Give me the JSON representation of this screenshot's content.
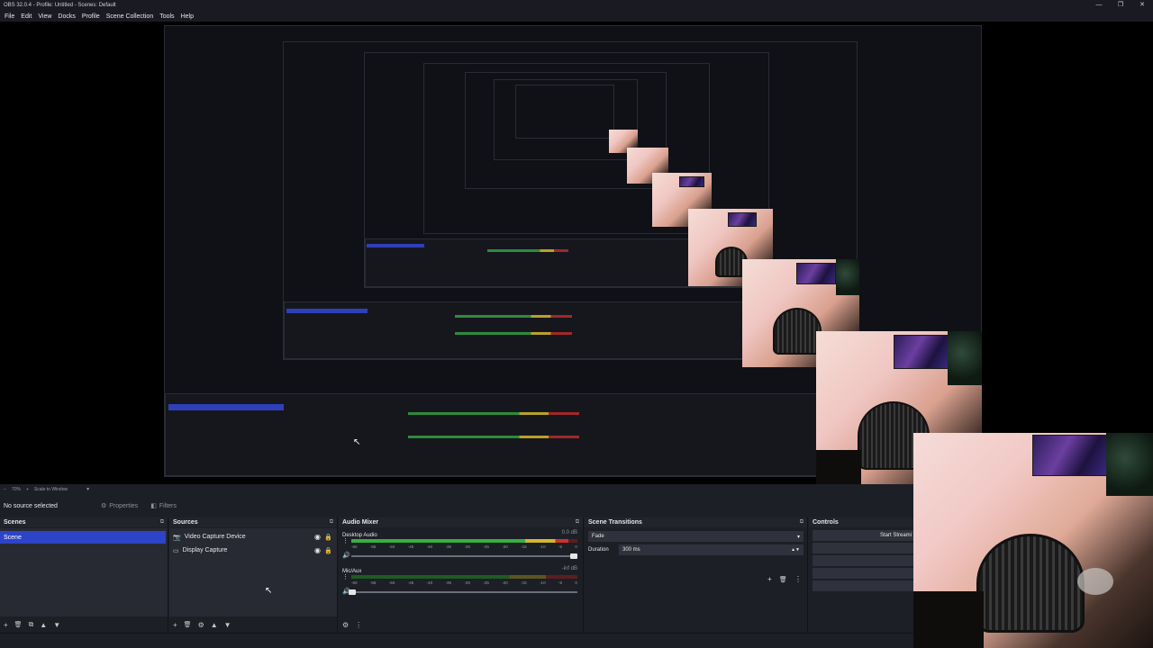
{
  "window": {
    "title": "OBS 32.0.4 - Profile: Untitled - Scenes: Default",
    "controls": [
      "—",
      "❐",
      "✕"
    ]
  },
  "menu": [
    "File",
    "Edit",
    "View",
    "Docks",
    "Profile",
    "Scene Collection",
    "Tools",
    "Help"
  ],
  "preview": {
    "zoom": "70%",
    "scale_mode": "Scale to Window"
  },
  "source_toolbar": {
    "no_source": "No source selected",
    "properties": "Properties",
    "filters": "Filters"
  },
  "scenes": {
    "title": "Scenes",
    "items": [
      "Scene"
    ],
    "footer_icons": [
      "+",
      "🗑",
      "⧉",
      "▲",
      "▼"
    ]
  },
  "sources": {
    "title": "Sources",
    "items": [
      {
        "label": "Video Capture Device",
        "icon": "camera-icon"
      },
      {
        "label": "Display Capture",
        "icon": "monitor-icon"
      }
    ],
    "footer_icons": [
      "+",
      "🗑",
      "⚙",
      "▲",
      "▼"
    ]
  },
  "audio_mixer": {
    "title": "Audio Mixer",
    "channels": [
      {
        "name": "Desktop Audio",
        "db": "0.0 dB",
        "level": 0.96,
        "volume": 1.0
      },
      {
        "name": "Mic/Aux",
        "db": "-inf dB",
        "level": 0.0,
        "volume": 0.02
      }
    ],
    "ticks": [
      "-60",
      "-55",
      "-50",
      "-45",
      "-40",
      "-35",
      "-30",
      "-25",
      "-20",
      "-15",
      "-10",
      "-5",
      "0"
    ],
    "footer_icons": [
      "⚙",
      "⋮"
    ]
  },
  "transitions": {
    "title": "Scene Transitions",
    "selected": "Fade",
    "duration_label": "Duration",
    "duration_value": "300 ms",
    "tools": [
      "+",
      "🗑",
      "⋮"
    ]
  },
  "controls": {
    "title": "Controls",
    "start_streaming": "Start Streami"
  },
  "colors": {
    "accent": "#2d43c8",
    "dock_bg": "#272a33",
    "meter_green": "#36b043",
    "meter_yellow": "#d5b62c",
    "meter_red": "#d03030"
  }
}
